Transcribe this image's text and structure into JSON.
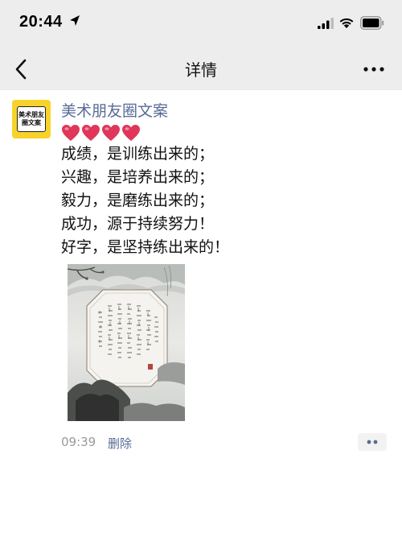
{
  "status_bar": {
    "time": "20:44",
    "location_icon": "location-arrow-icon",
    "signal_icon": "cellular-signal-icon",
    "wifi_icon": "wifi-icon",
    "battery_icon": "battery-icon"
  },
  "nav": {
    "back_icon": "chevron-left-icon",
    "title": "详情",
    "more_icon": "more-dots-icon"
  },
  "post": {
    "author": "美术朋友圈文案",
    "avatar_text": [
      "美术朋友",
      "圈文案"
    ],
    "hearts_count": 4,
    "heart_color": "#e0365a",
    "lines": [
      "成绩，是训练出来的；",
      "兴趣，是培养出来的；",
      "毅力，是磨练出来的；",
      "成功，源于持续努力！",
      "好字，是坚持练出来的！"
    ],
    "timestamp": "09:39",
    "delete_label": "删除",
    "action_icon": "comment-dots-icon"
  },
  "colors": {
    "bar_background": "#ededed",
    "link_blue": "#576b95",
    "meta_gray": "#9a9a9a",
    "avatar_yellow": "#f7d22a"
  }
}
